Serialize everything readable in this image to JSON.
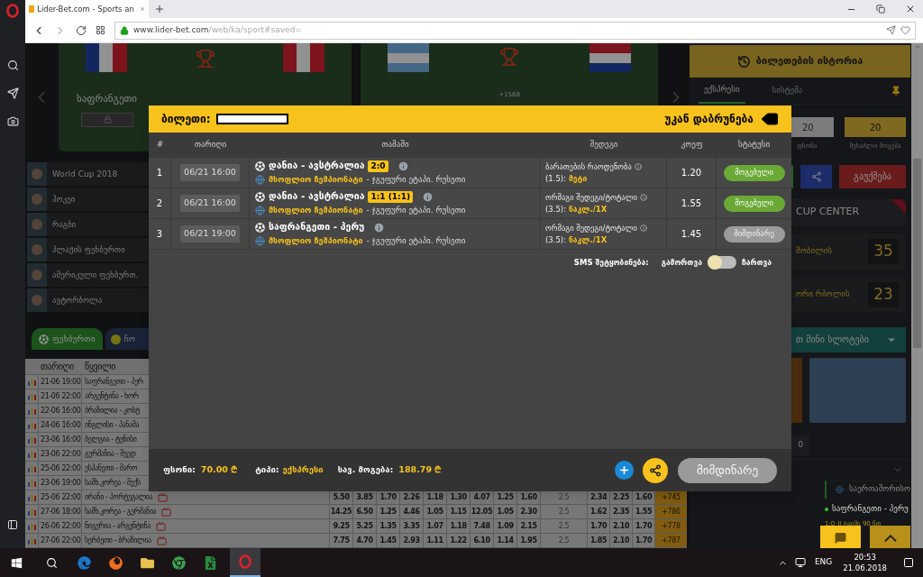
{
  "browser": {
    "tab_title": "Lider-Bet.com - Sports an",
    "url_domain": "www.lider-bet.com",
    "url_path": "/web/ka/sport#saved="
  },
  "banners": {
    "left_team": "საფრანგეთი",
    "right_counter": "+1568"
  },
  "sports": [
    {
      "label": "World Cup 2018"
    },
    {
      "label": "ჰოკეი"
    },
    {
      "label": "რაგბი"
    },
    {
      "label": "პლაჟის ფეხბურთი"
    },
    {
      "label": "ამერიკული ფეხბურთ."
    },
    {
      "label": "ავტორბოლა"
    }
  ],
  "sport_tabs": [
    {
      "label": "ფეხბურთი",
      "selected": true
    },
    {
      "label": "ჩო",
      "selected": false
    }
  ],
  "match_table": {
    "columns": [
      "თარიღი",
      "წყვილი"
    ],
    "rows": [
      {
        "date": "21-06 19:00",
        "pair": "საფრანგეთი - პერ"
      },
      {
        "date": "21-06 22:00",
        "pair": "არგენტინა - ხორ"
      },
      {
        "date": "22-06 16:00",
        "pair": "ბრაზილია - კოსტ"
      },
      {
        "date": "24-06 16:00",
        "pair": "ინგლისი - პანამა"
      },
      {
        "date": "23-06 16:00",
        "pair": "ბელგია - ტუნისი"
      },
      {
        "date": "23-06 22:00",
        "pair": "გერმანია - შვედ"
      },
      {
        "date": "25-06 22:00",
        "pair": "ესპანეთი - მარო"
      },
      {
        "date": "23-06 19:00",
        "pair": "სამხ.კორეა - მექს"
      },
      {
        "date": "25-06 22:00",
        "pair": "ირანი - პორტუგალია",
        "tv": true,
        "odds_a": [
          "5.50",
          "3.85",
          "1.70",
          "2.26",
          "1.18",
          "1.30",
          "4.07",
          "1.25",
          "1.60"
        ],
        "line": "2.5",
        "odds_b": [
          "2.34",
          "2.25",
          "1.60"
        ],
        "more": "+745"
      },
      {
        "date": "27-06 18:00",
        "pair": "სამხ.კორეა - გერმანია",
        "tv": true,
        "odds_a": [
          "14.25",
          "6.50",
          "1.25",
          "4.46",
          "1.05",
          "1.15",
          "12.05",
          "1.05",
          "2.30"
        ],
        "line": "2.5",
        "odds_b": [
          "1.62",
          "2.35",
          "1.55"
        ],
        "more": "+786"
      },
      {
        "date": "26-06 22:00",
        "pair": "ნიგერია - არგენტინა",
        "tv": true,
        "odds_a": [
          "9.25",
          "5.25",
          "1.35",
          "3.35",
          "1.07",
          "1.18",
          "7.48",
          "1.09",
          "2.15"
        ],
        "line": "2.5",
        "odds_b": [
          "1.70",
          "2.10",
          "1.70"
        ],
        "more": "+778"
      },
      {
        "date": "27-06 22:00",
        "pair": "სერბეთი - ბრაზილია",
        "tv": true,
        "odds_a": [
          "7.75",
          "4.70",
          "1.45",
          "2.93",
          "1.11",
          "1.22",
          "6.10",
          "1.14",
          "1.95"
        ],
        "line": "2.5",
        "odds_b": [
          "1.85",
          "2.10",
          "1.70"
        ],
        "more": "+787"
      }
    ]
  },
  "betslip": {
    "history_button": "ბილეთების ისტორია",
    "tabs": [
      {
        "label": "ექსპრესი",
        "selected": true
      },
      {
        "label": "სისტემა",
        "selected": false
      }
    ],
    "stake_value": "20",
    "stake_label": "ფსონი",
    "win_value": "20",
    "win_label": "შესაძლო მოგება",
    "cancel_button": "გაუქმება"
  },
  "cup_center": {
    "title": "CUP CENTER",
    "promos": [
      {
        "text": "მობილის",
        "value": "35"
      },
      {
        "text": "ორი რბოლის",
        "value": "23"
      }
    ]
  },
  "slots": {
    "title": "თ მინი სლოტები",
    "tail": "0"
  },
  "live": {
    "category": "საერთაშორისო",
    "match": "საფრანგეთი - პერუ",
    "score": "1:0",
    "period": "II ტაიმი 90 წთ"
  },
  "ticket": {
    "title": "ბილეთი:",
    "back": "უკან დაბრუნება",
    "columns": [
      "#",
      "თარიღი",
      "თამაში",
      "შედეგი",
      "კოეფ",
      "სტატუსი"
    ],
    "bets": [
      {
        "num": "1",
        "date": "06/21 16:00",
        "match": "დანია - ავსტრალია",
        "score": "2:0",
        "league": "მსოფლიო ჩემპიონატი",
        "stage": "- ჯგუფური ეტაპი. რუსეთი",
        "market": "ბარათების რაოდენობა",
        "line": "(1.5):",
        "pick": "მეტი",
        "odds": "1.20",
        "kind": "won",
        "status": "მოგებული"
      },
      {
        "num": "2",
        "date": "06/21 16:00",
        "match": "დანია - ავსტრალია",
        "score": "1:1 (1:1)",
        "league": "მსოფლიო ჩემპიონატი",
        "stage": "- ჯგუფური ეტაპი. რუსეთი",
        "market": "ორმაგი შედეგი/ტოტალი",
        "line": "(3.5):",
        "pick": "ნაკლ./1X",
        "odds": "1.55",
        "kind": "won",
        "status": "მოგებული"
      },
      {
        "num": "3",
        "date": "06/21 19:00",
        "match": "საფრანგეთი - პერუ",
        "league": "მსოფლიო ჩემპიონატი",
        "stage": "- ჯგუფური ეტაპი. რუსეთი",
        "market": "ორმაგი შედეგი/ტოტალი",
        "line": "(3.5):",
        "pick": "ნაკლ./1X",
        "odds": "1.45",
        "kind": "pending",
        "status": "მიმდინარე"
      }
    ],
    "sms": {
      "label": "SMS შეტყობინება:",
      "off_label": "გამორთვა",
      "on_label": "ჩართვა",
      "on": false
    },
    "stake_label": "ფსონი:",
    "stake": "70.00 ₾",
    "type_label": "ტიპი:",
    "type": "ექსპრესი",
    "win_label": "სავ. მოგება:",
    "win": "188.79 ₾",
    "state_button": "მიმდინარე"
  },
  "taskbar": {
    "lang": "ENG",
    "time": "20:53",
    "date": "21.06.2018"
  }
}
